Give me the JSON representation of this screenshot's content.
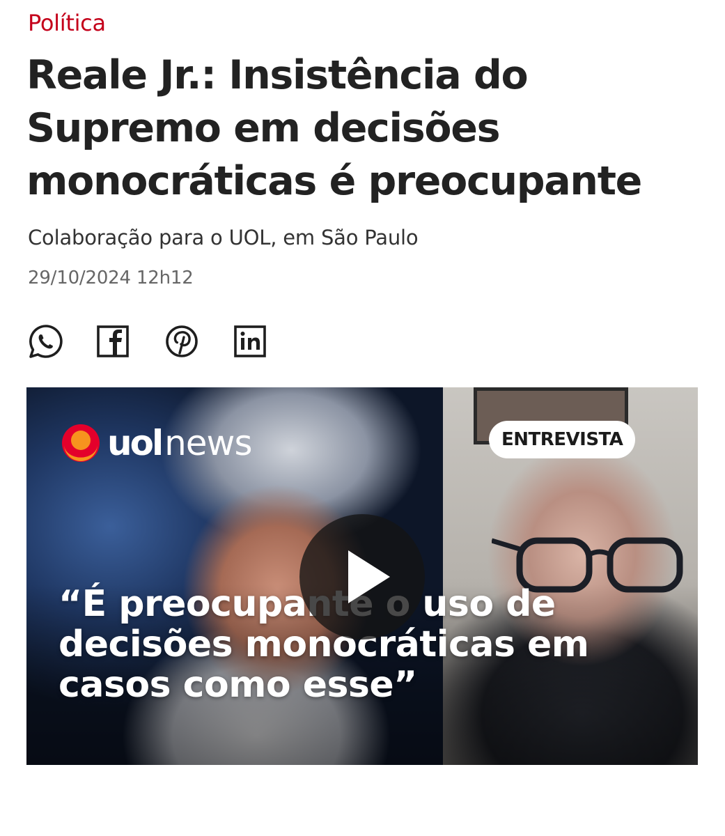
{
  "article": {
    "section": "Política",
    "headline": "Reale Jr.: Insistência do Supremo em decisões monocráticas é preocupante",
    "byline": "Colaboração para o UOL, em São Paulo",
    "date": "29/10/2024 12h12"
  },
  "share": {
    "icons": [
      "whatsapp-icon",
      "facebook-icon",
      "pinterest-icon",
      "linkedin-icon"
    ]
  },
  "video": {
    "logo_bold": "uol",
    "logo_light": "news",
    "badge": "ENTREVISTA",
    "quote": "“É preocupante o uso de decisões monocráticas em casos como esse”"
  },
  "colors": {
    "section": "#c4001a",
    "headline": "#222222",
    "logo_orange": "#f7931e",
    "logo_red": "#e4002b"
  }
}
